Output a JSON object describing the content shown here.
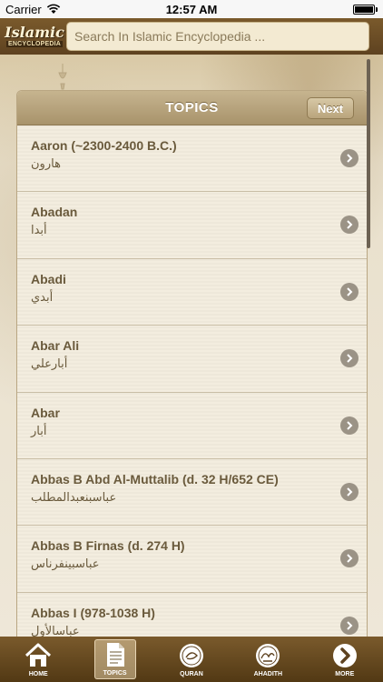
{
  "status": {
    "carrier": "Carrier",
    "time": "12:57 AM"
  },
  "header": {
    "logo_line1": "Islamic",
    "logo_line2": "ENCYCLOPEDIA",
    "search_placeholder": "Search In Islamic Encyclopedia ..."
  },
  "panel": {
    "title": "TOPICS",
    "next_label": "Next"
  },
  "topics": [
    {
      "en": "Aaron (~2300-2400 B.C.)",
      "ar": "هارون"
    },
    {
      "en": "Abadan",
      "ar": "أبدا"
    },
    {
      "en": "Abadi",
      "ar": "أبدي"
    },
    {
      "en": "Abar Ali",
      "ar": "أبارعلي"
    },
    {
      "en": "Abar",
      "ar": "أبار"
    },
    {
      "en": "Abbas B Abd Al-Muttalib (d. 32 H/652 CE)",
      "ar": "عباسبنعبدالمطلب"
    },
    {
      "en": "Abbas B Firnas (d. 274 H)",
      "ar": "عباسبينفرناس"
    },
    {
      "en": "Abbas I (978-1038 H)",
      "ar": "عباسالأول"
    }
  ],
  "tabs": [
    {
      "label": "HOME",
      "icon": "home-icon"
    },
    {
      "label": "TOPICS",
      "icon": "document-icon"
    },
    {
      "label": "QURAN",
      "icon": "quran-icon"
    },
    {
      "label": "AHADITH",
      "icon": "ahadith-icon"
    },
    {
      "label": "MORE",
      "icon": "chevron-right-circle-icon"
    }
  ]
}
